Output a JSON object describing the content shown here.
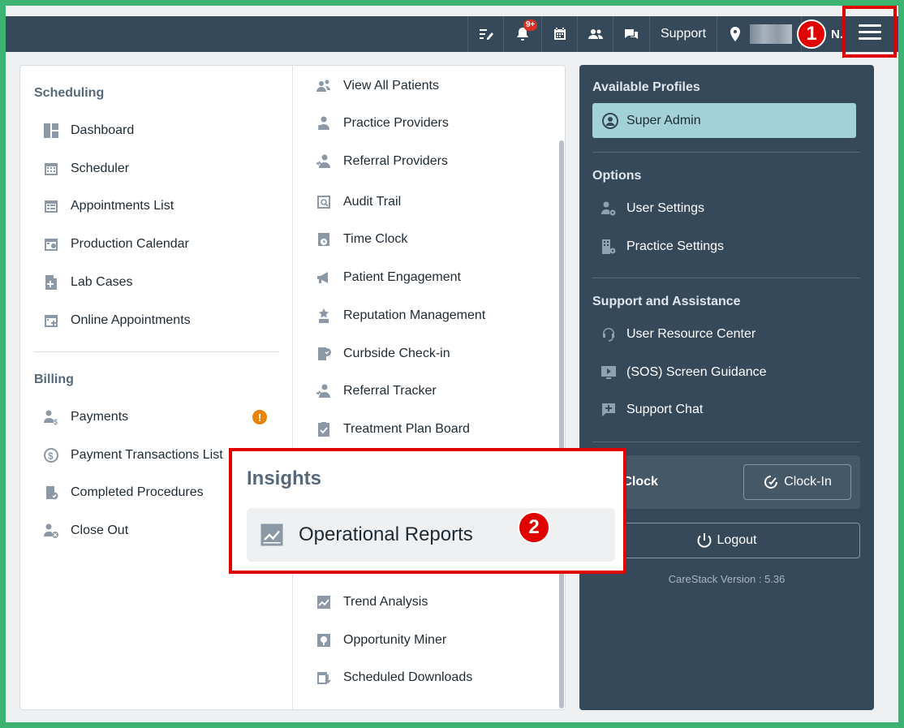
{
  "topbar": {
    "notification_count": "9+",
    "support_label": "Support",
    "user_initials": "N."
  },
  "markers": {
    "one": "1",
    "two": "2"
  },
  "scheduling": {
    "title": "Scheduling",
    "items": [
      "Dashboard",
      "Scheduler",
      "Appointments List",
      "Production Calendar",
      "Lab Cases",
      "Online Appointments"
    ]
  },
  "billing": {
    "title": "Billing",
    "items": [
      "Payments",
      "Payment Transactions List",
      "Completed Procedures",
      "Close Out"
    ],
    "payments_alert": "!"
  },
  "middle": {
    "items": [
      "View All Patients",
      "Practice Providers",
      "Referral Providers",
      "Audit Trail",
      "Time Clock",
      "Patient Engagement",
      "Reputation Management",
      "Curbside Check-in",
      "Referral Tracker",
      "Treatment Plan Board"
    ],
    "bottom_items": [
      "Trend Analysis",
      "Opportunity Miner",
      "Scheduled Downloads"
    ]
  },
  "insights": {
    "title": "Insights",
    "item": "Operational Reports"
  },
  "right": {
    "profiles_title": "Available Profiles",
    "profile": "Super Admin",
    "options_title": "Options",
    "options": [
      "User Settings",
      "Practice Settings"
    ],
    "support_title": "Support and Assistance",
    "support_items": [
      "User Resource Center",
      "(SOS) Screen Guidance",
      "Support Chat"
    ],
    "clock_label": "e Clock",
    "clockin_label": "Clock-In",
    "logout_label": "Logout",
    "version": "CareStack Version : 5.36",
    "profile_color": "#a2d2d8",
    "panel_color": "#36495a"
  }
}
